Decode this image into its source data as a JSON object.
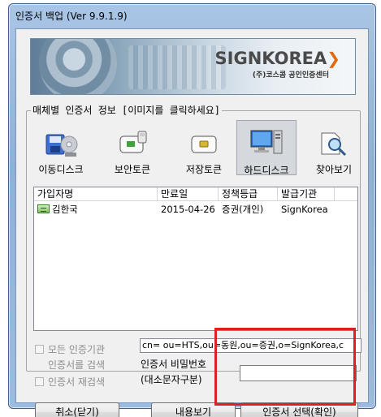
{
  "window": {
    "title": "인증서 백업  (Ver 9.9.1.9)"
  },
  "banner": {
    "brand": "SIGNKOREA",
    "subtitle": "(주)코스콤 공인인증센터"
  },
  "media_group": {
    "legend": "매체별 인증서 정보 [이미지를 클릭하세요]",
    "items": [
      {
        "label": "이동디스크",
        "icon": "removable-disk-icon",
        "selected": false
      },
      {
        "label": "보안토큰",
        "icon": "security-token-icon",
        "selected": false
      },
      {
        "label": "저장토큰",
        "icon": "storage-token-icon",
        "selected": false
      },
      {
        "label": "하드디스크",
        "icon": "hard-disk-icon",
        "selected": true
      },
      {
        "label": "찾아보기",
        "icon": "browse-icon",
        "selected": false
      }
    ]
  },
  "cert_list": {
    "columns": [
      "가입자명",
      "만료일",
      "정책등급",
      "발급기관"
    ],
    "rows": [
      {
        "name": "김한국",
        "expiry": "2015-04-26",
        "policy": "증권(개인)",
        "issuer": "SignKorea"
      }
    ]
  },
  "options": {
    "all_issuers": "모든 인증기관",
    "all_issuers_2": "인증서를 검색",
    "research": "인증서 재검색"
  },
  "dn": "cn=          ou=HTS,ou=동원,ou=증권,o=SignKorea,c",
  "password": {
    "label_line1": "인증서 비밀번호",
    "label_line2": "(대소문자구분)",
    "value": ""
  },
  "buttons": {
    "cancel": "취소(닫기)",
    "view": "내용보기",
    "select": "인증서 선택(확인)"
  }
}
